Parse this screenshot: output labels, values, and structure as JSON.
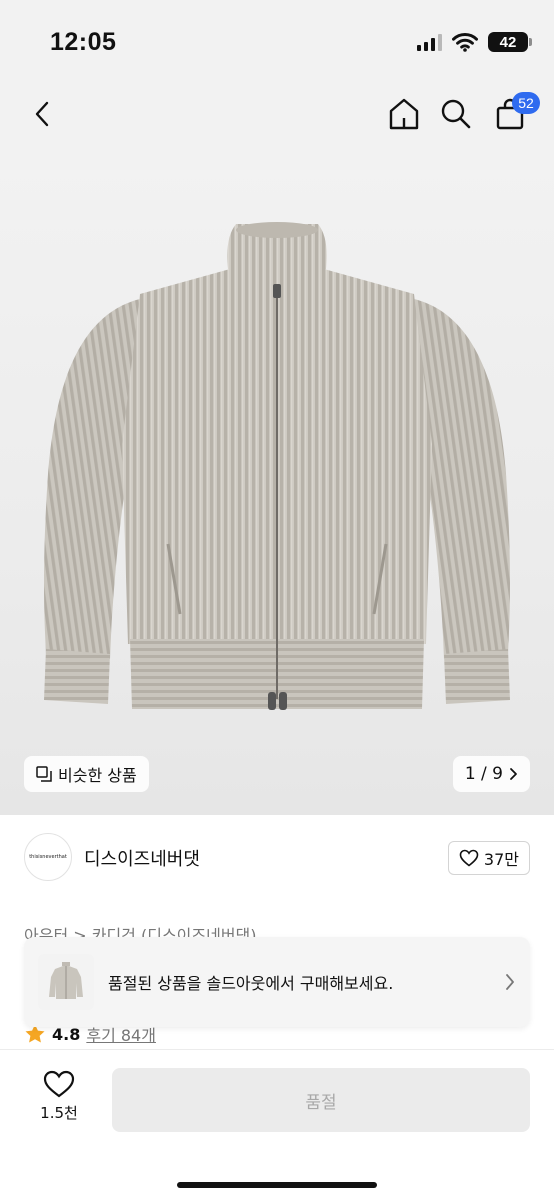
{
  "status_bar": {
    "time": "12:05",
    "battery": "42"
  },
  "nav": {
    "cart_count": "52"
  },
  "image": {
    "similar_label": "비슷한 상품",
    "page_indicator": "1 / 9"
  },
  "brand": {
    "logo_text": "thisisneverthat",
    "name": "디스이즈네버댓",
    "likes": "37만"
  },
  "breadcrumb": "아우터 > 카디건 (디스이즈네버댓)",
  "rating": {
    "score": "4.8",
    "reviews": "후기 84개"
  },
  "banner": {
    "text": "품절된 상품을 솔드아웃에서 구매해보세요."
  },
  "bottom": {
    "wish_count": "1.5천",
    "buy_label": "품절"
  },
  "colors": {
    "accent": "#2f6bef",
    "star": "#f5a623",
    "disabled_bg": "#ebebeb",
    "disabled_text": "#a8a8a8"
  },
  "icons": [
    "back-icon",
    "home-icon",
    "search-icon",
    "cart-icon",
    "copy-icon",
    "chevron-right-icon",
    "heart-icon",
    "star-icon"
  ]
}
